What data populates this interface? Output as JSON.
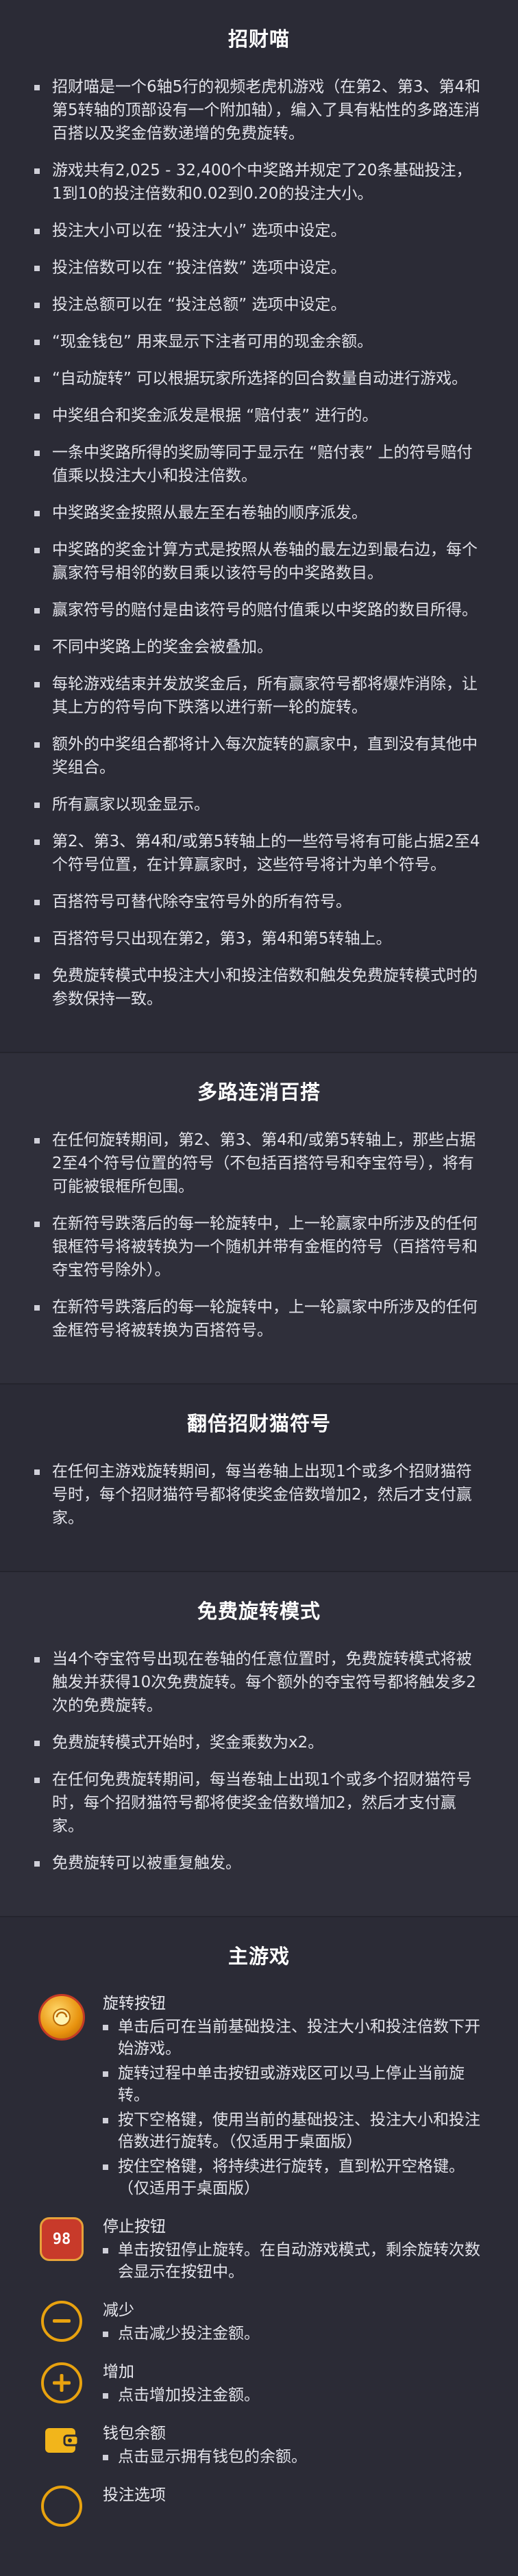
{
  "sections": [
    {
      "title": "招财喵",
      "items": [
        "招财喵是一个6轴5行的视频老虎机游戏（在第2、第3、第4和第5转轴的顶部设有一个附加轴），编入了具有粘性的多路连消百搭以及奖金倍数递增的免费旋转。",
        "游戏共有2,025 - 32,400个中奖路并规定了20条基础投注， 1到10的投注倍数和0.02到0.20的投注大小。",
        "投注大小可以在 “投注大小” 选项中设定。",
        "投注倍数可以在 “投注倍数” 选项中设定。",
        "投注总额可以在 “投注总额” 选项中设定。",
        "“现金钱包” 用来显示下注者可用的现金余额。",
        "“自动旋转” 可以根据玩家所选择的回合数量自动进行游戏。",
        "中奖组合和奖金派发是根据 “赔付表” 进行的。",
        "一条中奖路所得的奖励等同于显示在 “赔付表” 上的符号赔付值乘以投注大小和投注倍数。",
        "中奖路奖金按照从最左至右卷轴的顺序派发。",
        "中奖路的奖金计算方式是按照从卷轴的最左边到最右边，每个赢家符号相邻的数目乘以该符号的中奖路数目。",
        "赢家符号的赔付是由该符号的赔付值乘以中奖路的数目所得。",
        "不同中奖路上的奖金会被叠加。",
        "每轮游戏结束并发放奖金后，所有赢家符号都将爆炸消除，让其上方的符号向下跌落以进行新一轮的旋转。",
        "额外的中奖组合都将计入每次旋转的赢家中，直到没有其他中奖组合。",
        "所有赢家以现金显示。",
        "第2、第3、第4和/或第5转轴上的一些符号将有可能占据2至4个符号位置，在计算赢家时，这些符号将计为单个符号。",
        "百搭符号可替代除夺宝符号外的所有符号。",
        "百搭符号只出现在第2，第3，第4和第5转轴上。",
        "免费旋转模式中投注大小和投注倍数和触发免费旋转模式时的参数保持一致。"
      ]
    },
    {
      "title": "多路连消百搭",
      "items": [
        "在任何旋转期间，第2、第3、第4和/或第5转轴上，那些占据2至4个符号位置的符号（不包括百搭符号和夺宝符号），将有可能被银框所包围。",
        "在新符号跌落后的每一轮旋转中，上一轮赢家中所涉及的任何银框符号将被转换为一个随机并带有金框的符号（百搭符号和夺宝符号除外）。",
        "在新符号跌落后的每一轮旋转中，上一轮赢家中所涉及的任何金框符号将被转换为百搭符号。"
      ]
    },
    {
      "title": "翻倍招财猫符号",
      "items": [
        "在任何主游戏旋转期间，每当卷轴上出现1个或多个招财猫符号时，每个招财猫符号都将使奖金倍数增加2，然后才支付赢家。"
      ]
    },
    {
      "title": "免费旋转模式",
      "items": [
        "当4个夺宝符号出现在卷轴的任意位置时，免费旋转模式将被触发并获得10次免费旋转。每个额外的夺宝符号都将触发多2次的免费旋转。",
        "免费旋转模式开始时，奖金乘数为x2。",
        "在任何免费旋转期间，每当卷轴上出现1个或多个招财猫符号时，每个招财猫符号都将使奖金倍数增加2，然后才支付赢家。",
        "免费旋转可以被重复触发。"
      ]
    }
  ],
  "main_game": {
    "title": "主游戏",
    "controls": [
      {
        "icon": "spin-button-icon",
        "name": "旋转按钮",
        "items": [
          "单击后可在当前基础投注、投注大小和投注倍数下开始游戏。",
          "旋转过程中单击按钮或游戏区可以马上停止当前旋转。",
          "按下空格键，使用当前的基础投注、投注大小和投注倍数进行旋转。（仅适用于桌面版）",
          "按住空格键，将持续进行旋转，直到松开空格键。（仅适用于桌面版）"
        ]
      },
      {
        "icon": "stop-button-icon",
        "icon_text": "98",
        "name": "停止按钮",
        "items": [
          "单击按钮停止旋转。在自动游戏模式，剩余旋转次数会显示在按钮中。"
        ]
      },
      {
        "icon": "minus-icon",
        "name": "减少",
        "items": [
          "点击减少投注金额。"
        ]
      },
      {
        "icon": "plus-icon",
        "name": "增加",
        "items": [
          "点击增加投注金额。"
        ]
      },
      {
        "icon": "wallet-icon",
        "name": "钱包余额",
        "items": [
          "点击显示拥有钱包的余额。"
        ]
      },
      {
        "icon": "bet-options-icon",
        "name": "投注选项",
        "items": []
      }
    ]
  },
  "colors": {
    "background": "#2b2b36",
    "gold": "#f2b51b",
    "stop_red": "#c83a2a"
  }
}
